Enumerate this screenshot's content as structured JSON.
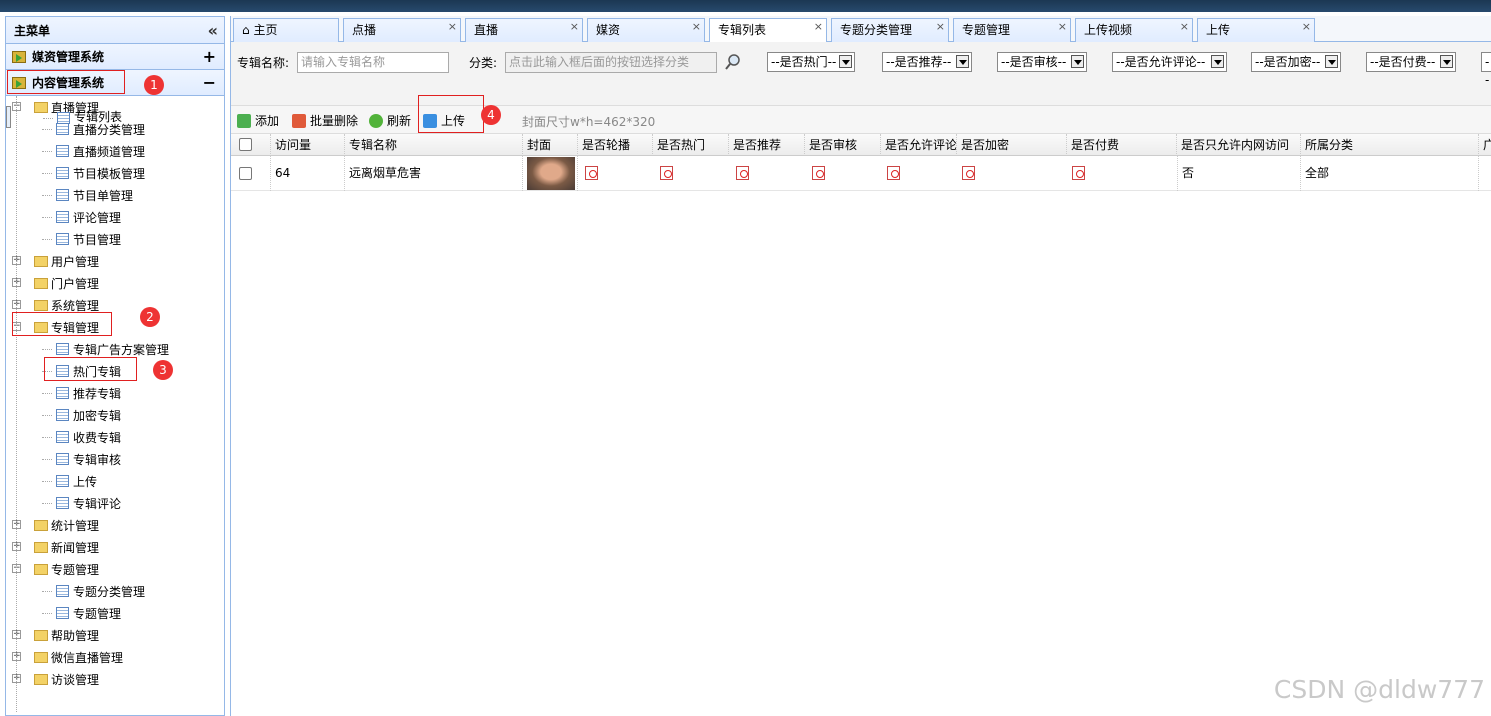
{
  "sidebar": {
    "title": "主菜单",
    "collapse_icon": "«",
    "sections": [
      {
        "label": "媒资管理系统",
        "toggle": "+"
      },
      {
        "label": "内容管理系统",
        "toggle": "−"
      }
    ],
    "tree": [
      {
        "label": "直播管理",
        "type": "folder",
        "expanded": true
      },
      {
        "label": "直播分类管理",
        "type": "page"
      },
      {
        "label": "直播频道管理",
        "type": "page"
      },
      {
        "label": "节目模板管理",
        "type": "page"
      },
      {
        "label": "节目单管理",
        "type": "page"
      },
      {
        "label": "评论管理",
        "type": "page"
      },
      {
        "label": "节目管理",
        "type": "page"
      },
      {
        "label": "用户管理",
        "type": "folder"
      },
      {
        "label": "门户管理",
        "type": "folder"
      },
      {
        "label": "系统管理",
        "type": "folder"
      },
      {
        "label": "专辑管理",
        "type": "folder",
        "expanded": true
      },
      {
        "label": "专辑广告方案管理",
        "type": "page"
      },
      {
        "label": "专辑列表",
        "type": "page",
        "selected": true
      },
      {
        "label": "热门专辑",
        "type": "page"
      },
      {
        "label": "推荐专辑",
        "type": "page"
      },
      {
        "label": "加密专辑",
        "type": "page"
      },
      {
        "label": "收费专辑",
        "type": "page"
      },
      {
        "label": "专辑审核",
        "type": "page"
      },
      {
        "label": "上传",
        "type": "page"
      },
      {
        "label": "专辑评论",
        "type": "page"
      },
      {
        "label": "统计管理",
        "type": "folder"
      },
      {
        "label": "新闻管理",
        "type": "folder"
      },
      {
        "label": "专题管理",
        "type": "folder",
        "expanded": true
      },
      {
        "label": "专题分类管理",
        "type": "page"
      },
      {
        "label": "专题管理",
        "type": "page"
      },
      {
        "label": "帮助管理",
        "type": "folder"
      },
      {
        "label": "微信直播管理",
        "type": "folder"
      },
      {
        "label": "访谈管理",
        "type": "folder"
      }
    ]
  },
  "badges": [
    "1",
    "2",
    "3",
    "4"
  ],
  "tabs": [
    {
      "label": "主页",
      "icon": "home-icon"
    },
    {
      "label": "点播"
    },
    {
      "label": "直播"
    },
    {
      "label": "媒资"
    },
    {
      "label": "专辑列表",
      "active": true
    },
    {
      "label": "专题分类管理"
    },
    {
      "label": "专题管理"
    },
    {
      "label": "上传视频"
    },
    {
      "label": "上传"
    }
  ],
  "search": {
    "name_label": "专辑名称:",
    "name_placeholder": "请输入专辑名称",
    "category_label": "分类:",
    "category_placeholder": "点击此输入框后面的按钮选择分类",
    "selects": [
      "--是否热门--",
      "--是否推荐--",
      "--是否审核--",
      "--是否允许评论--",
      "--是否加密--",
      "--是否付费--",
      "--"
    ]
  },
  "toolbar": {
    "add": "添加",
    "batch_delete": "批量删除",
    "refresh": "刷新",
    "upload": "上传",
    "cover_hint": "封面尺寸w*h=462*320"
  },
  "grid": {
    "columns": [
      "访问量",
      "专辑名称",
      "封面",
      "是否轮播",
      "是否热门",
      "是否推荐",
      "是否审核",
      "是否允许评论",
      "是否加密",
      "是否付费",
      "是否只允许内网访问",
      "所属分类",
      "广"
    ],
    "rows": [
      {
        "visits": "64",
        "name": "远离烟草危害",
        "intranet": "否",
        "category": "全部"
      }
    ]
  },
  "watermark": "CSDN @dldw777"
}
